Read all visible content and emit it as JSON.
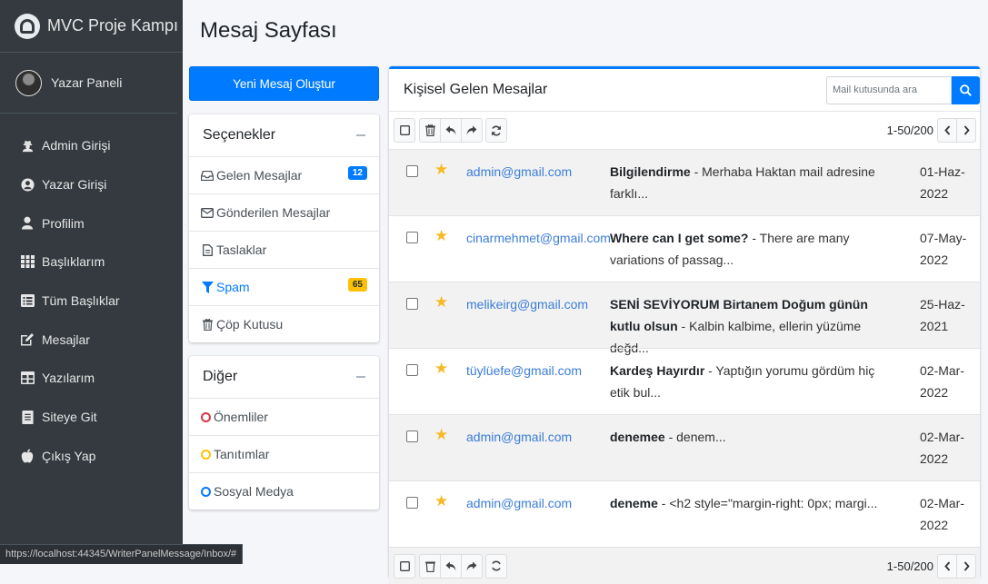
{
  "app": {
    "brand": "MVC Proje Kampı",
    "user_panel": "Yazar Paneli"
  },
  "sidebar": {
    "items": [
      {
        "label": "Admin Girişi",
        "icon": "user-secret-icon"
      },
      {
        "label": "Yazar Girişi",
        "icon": "user-circle-icon"
      },
      {
        "label": "Profilim",
        "icon": "user-icon"
      },
      {
        "label": "Başlıklarım",
        "icon": "th-icon"
      },
      {
        "label": "Tüm Başlıklar",
        "icon": "list-alt-icon"
      },
      {
        "label": "Mesajlar",
        "icon": "edit-icon"
      },
      {
        "label": "Yazılarım",
        "icon": "table-icon"
      },
      {
        "label": "Siteye Git",
        "icon": "file-text-icon"
      },
      {
        "label": "Çıkış Yap",
        "icon": "apple-icon"
      }
    ]
  },
  "status_url": "https://localhost:44345/WriterPanelMessage/Inbox/#",
  "page": {
    "title": "Mesaj Sayfası",
    "new_message_button": "Yeni Mesaj Oluştur"
  },
  "options": {
    "title": "Seçenekler",
    "folders": [
      {
        "label": "Gelen Mesajlar",
        "icon": "inbox-icon",
        "badge": "12"
      },
      {
        "label": "Gönderilen Mesajlar",
        "icon": "envelope-icon"
      },
      {
        "label": "Taslaklar",
        "icon": "file-icon"
      },
      {
        "label": "Spam",
        "icon": "filter-icon",
        "badge": "65"
      },
      {
        "label": "Çöp Kutusu",
        "icon": "trash-icon"
      }
    ]
  },
  "other": {
    "title": "Diğer",
    "labels": [
      {
        "label": "Önemliler",
        "color": "#dc3545"
      },
      {
        "label": "Tanıtımlar",
        "color": "#ffc107"
      },
      {
        "label": "Sosyal Medya",
        "color": "#007bff"
      }
    ]
  },
  "mailbox": {
    "title": "Kişisel Gelen Mesajlar",
    "search_placeholder": "Mail kutusunda ara",
    "pagination": "1-50/200",
    "messages": [
      {
        "sender": "admin@gmail.com",
        "subject": "Bilgilendirme",
        "preview": " - Merhaba Haktan mail adresine farklı...",
        "date": "01-Haz-2022"
      },
      {
        "sender": "cinarmehmet@gmail.com",
        "subject": "Where can I get some?",
        "preview": " - There are many variations of passag...",
        "date": "07-May-2022"
      },
      {
        "sender": "melikeirg@gmail.com",
        "subject": "SENİ SEVİYORUM Birtanem Doğum günün kutlu olsun",
        "preview": " - Kalbin kalbime, ellerin yüzüme değd...",
        "date": "25-Haz-2021"
      },
      {
        "sender": "tüylüefe@gmail.com",
        "subject": "Kardeş Hayırdır",
        "preview": " - Yaptığın yorumu gördüm hiç etik bul...",
        "date": "02-Mar-2022"
      },
      {
        "sender": "admin@gmail.com",
        "subject": "denemee",
        "preview": " - denem...",
        "date": "02-Mar-2022"
      },
      {
        "sender": "admin@gmail.com",
        "subject": "deneme",
        "preview": " - <h2 style=\"margin-right: 0px; margi...",
        "date": "02-Mar-2022"
      }
    ]
  }
}
